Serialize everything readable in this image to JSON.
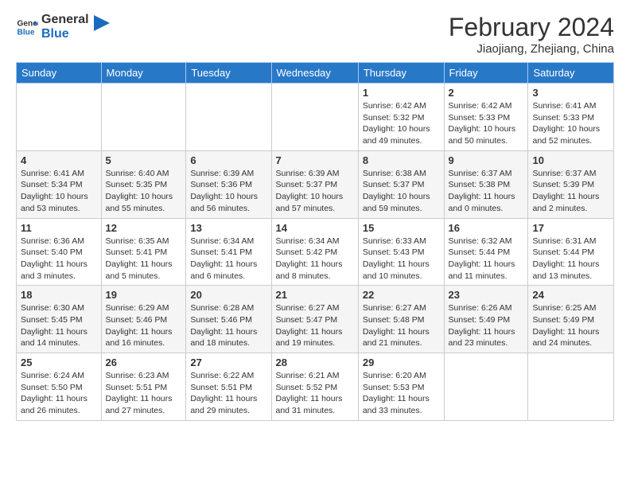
{
  "header": {
    "logo_general": "General",
    "logo_blue": "Blue",
    "title": "February 2024",
    "location": "Jiaojiang, Zhejiang, China"
  },
  "days_of_week": [
    "Sunday",
    "Monday",
    "Tuesday",
    "Wednesday",
    "Thursday",
    "Friday",
    "Saturday"
  ],
  "weeks": [
    [
      {
        "day": "",
        "sunrise": "",
        "sunset": "",
        "daylight": ""
      },
      {
        "day": "",
        "sunrise": "",
        "sunset": "",
        "daylight": ""
      },
      {
        "day": "",
        "sunrise": "",
        "sunset": "",
        "daylight": ""
      },
      {
        "day": "",
        "sunrise": "",
        "sunset": "",
        "daylight": ""
      },
      {
        "day": "1",
        "sunrise": "6:42 AM",
        "sunset": "5:32 PM",
        "daylight": "10 hours and 49 minutes."
      },
      {
        "day": "2",
        "sunrise": "6:42 AM",
        "sunset": "5:33 PM",
        "daylight": "10 hours and 50 minutes."
      },
      {
        "day": "3",
        "sunrise": "6:41 AM",
        "sunset": "5:33 PM",
        "daylight": "10 hours and 52 minutes."
      }
    ],
    [
      {
        "day": "4",
        "sunrise": "6:41 AM",
        "sunset": "5:34 PM",
        "daylight": "10 hours and 53 minutes."
      },
      {
        "day": "5",
        "sunrise": "6:40 AM",
        "sunset": "5:35 PM",
        "daylight": "10 hours and 55 minutes."
      },
      {
        "day": "6",
        "sunrise": "6:39 AM",
        "sunset": "5:36 PM",
        "daylight": "10 hours and 56 minutes."
      },
      {
        "day": "7",
        "sunrise": "6:39 AM",
        "sunset": "5:37 PM",
        "daylight": "10 hours and 57 minutes."
      },
      {
        "day": "8",
        "sunrise": "6:38 AM",
        "sunset": "5:37 PM",
        "daylight": "10 hours and 59 minutes."
      },
      {
        "day": "9",
        "sunrise": "6:37 AM",
        "sunset": "5:38 PM",
        "daylight": "11 hours and 0 minutes."
      },
      {
        "day": "10",
        "sunrise": "6:37 AM",
        "sunset": "5:39 PM",
        "daylight": "11 hours and 2 minutes."
      }
    ],
    [
      {
        "day": "11",
        "sunrise": "6:36 AM",
        "sunset": "5:40 PM",
        "daylight": "11 hours and 3 minutes."
      },
      {
        "day": "12",
        "sunrise": "6:35 AM",
        "sunset": "5:41 PM",
        "daylight": "11 hours and 5 minutes."
      },
      {
        "day": "13",
        "sunrise": "6:34 AM",
        "sunset": "5:41 PM",
        "daylight": "11 hours and 6 minutes."
      },
      {
        "day": "14",
        "sunrise": "6:34 AM",
        "sunset": "5:42 PM",
        "daylight": "11 hours and 8 minutes."
      },
      {
        "day": "15",
        "sunrise": "6:33 AM",
        "sunset": "5:43 PM",
        "daylight": "11 hours and 10 minutes."
      },
      {
        "day": "16",
        "sunrise": "6:32 AM",
        "sunset": "5:44 PM",
        "daylight": "11 hours and 11 minutes."
      },
      {
        "day": "17",
        "sunrise": "6:31 AM",
        "sunset": "5:44 PM",
        "daylight": "11 hours and 13 minutes."
      }
    ],
    [
      {
        "day": "18",
        "sunrise": "6:30 AM",
        "sunset": "5:45 PM",
        "daylight": "11 hours and 14 minutes."
      },
      {
        "day": "19",
        "sunrise": "6:29 AM",
        "sunset": "5:46 PM",
        "daylight": "11 hours and 16 minutes."
      },
      {
        "day": "20",
        "sunrise": "6:28 AM",
        "sunset": "5:46 PM",
        "daylight": "11 hours and 18 minutes."
      },
      {
        "day": "21",
        "sunrise": "6:27 AM",
        "sunset": "5:47 PM",
        "daylight": "11 hours and 19 minutes."
      },
      {
        "day": "22",
        "sunrise": "6:27 AM",
        "sunset": "5:48 PM",
        "daylight": "11 hours and 21 minutes."
      },
      {
        "day": "23",
        "sunrise": "6:26 AM",
        "sunset": "5:49 PM",
        "daylight": "11 hours and 23 minutes."
      },
      {
        "day": "24",
        "sunrise": "6:25 AM",
        "sunset": "5:49 PM",
        "daylight": "11 hours and 24 minutes."
      }
    ],
    [
      {
        "day": "25",
        "sunrise": "6:24 AM",
        "sunset": "5:50 PM",
        "daylight": "11 hours and 26 minutes."
      },
      {
        "day": "26",
        "sunrise": "6:23 AM",
        "sunset": "5:51 PM",
        "daylight": "11 hours and 27 minutes."
      },
      {
        "day": "27",
        "sunrise": "6:22 AM",
        "sunset": "5:51 PM",
        "daylight": "11 hours and 29 minutes."
      },
      {
        "day": "28",
        "sunrise": "6:21 AM",
        "sunset": "5:52 PM",
        "daylight": "11 hours and 31 minutes."
      },
      {
        "day": "29",
        "sunrise": "6:20 AM",
        "sunset": "5:53 PM",
        "daylight": "11 hours and 33 minutes."
      },
      {
        "day": "",
        "sunrise": "",
        "sunset": "",
        "daylight": ""
      },
      {
        "day": "",
        "sunrise": "",
        "sunset": "",
        "daylight": ""
      }
    ]
  ],
  "labels": {
    "sunrise_prefix": "Sunrise: ",
    "sunset_prefix": "Sunset: ",
    "daylight_prefix": "Daylight: "
  }
}
